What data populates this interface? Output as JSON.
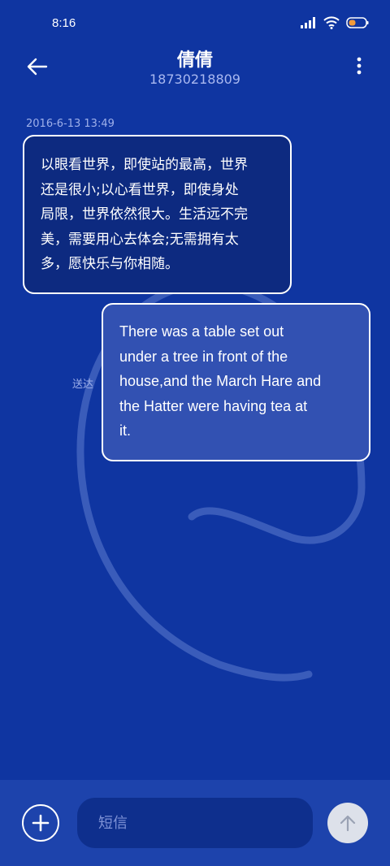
{
  "status_bar": {
    "time": "8:16",
    "icons": [
      "signal-icon",
      "wifi-icon",
      "battery-icon"
    ]
  },
  "header": {
    "contact_name": "倩倩",
    "phone_number": "18730218809",
    "icons": [
      "back-arrow-icon",
      "more-vertical-icon"
    ]
  },
  "conversation": {
    "timestamp": "2016-6-13 13:49",
    "received_message": {
      "lines": [
        "以眼看世界，即使站的最高，世界",
        "还是很小;以心看世界，即使身处",
        "局限，世界依然很大。生活远不完",
        "美，需要用心去体会;无需拥有太",
        "多，愿快乐与你相随。"
      ]
    },
    "sent_message": {
      "lines": [
        "There was a table set out",
        "under a tree in front of the",
        "house,and the March Hare and",
        "the Hatter were having tea at",
        "it."
      ],
      "status": "送达"
    }
  },
  "composer": {
    "placeholder": "短信",
    "value": "",
    "icons": [
      "add-icon",
      "send-arrow-icon"
    ]
  },
  "colors": {
    "background": "#0f35a1",
    "received_bubble": "#0d2a80",
    "sent_bubble": "#3251b2",
    "input_bar": "#1d43ac",
    "input_field": "#0e2f8d",
    "muted_text": "#9fb0ea"
  }
}
